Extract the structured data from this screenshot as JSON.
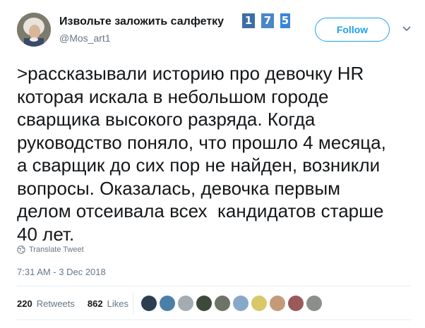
{
  "user": {
    "display_name": "Извольте заложить салфетку",
    "handle": "@Mos_art1",
    "badges": [
      "1",
      "7",
      "5"
    ]
  },
  "follow_label": "Follow",
  "tweet_text": ">рассказывали историю про девочку HR\nкоторая искала в небольшом городе\nсварщика высокого разряда. Когда\nруководство поняло, что прошло 4 месяца,\nа сварщик до сих пор не найден, возникли\nвопросы. Оказалась, девочка первым\nделом отсеивала всех  кандидатов старше\n40 лет.",
  "translate_label": "Translate Tweet",
  "timestamp": "7:31 AM - 3 Dec 2018",
  "stats": {
    "retweets_count": "220",
    "retweets_label": "Retweets",
    "likes_count": "862",
    "likes_label": "Likes"
  },
  "likers": [
    {
      "color": "#2d3e4f"
    },
    {
      "color": "#4a7fa8"
    },
    {
      "color": "#a3abb3"
    },
    {
      "color": "#3c4a3a"
    },
    {
      "color": "#6d7466"
    },
    {
      "color": "#87a9c9"
    },
    {
      "color": "#d9c86a"
    },
    {
      "color": "#c49a7a"
    },
    {
      "color": "#9a5a5a"
    },
    {
      "color": "#8a8f87"
    }
  ],
  "colors": {
    "accent": "#1da1f2",
    "secondary_text": "#657786",
    "text": "#14171a"
  }
}
